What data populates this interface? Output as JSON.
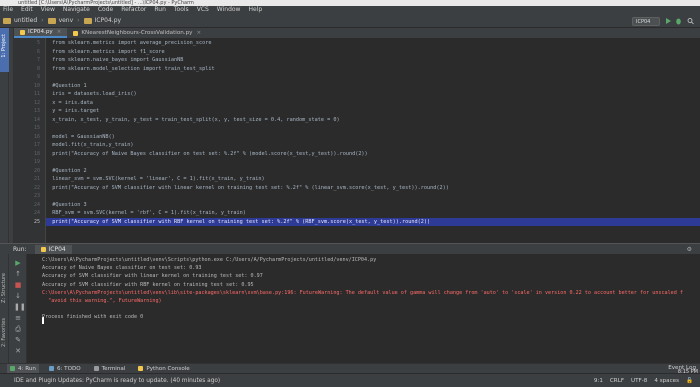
{
  "window": {
    "title": "untitled [C:\\Users\\A\\PycharmProjects\\untitled] - ...\\ICP04.py - PyCharm"
  },
  "menu": [
    "File",
    "Edit",
    "View",
    "Navigate",
    "Code",
    "Refactor",
    "Run",
    "Tools",
    "VCS",
    "Window",
    "Help"
  ],
  "breadcrumb": [
    "untitled",
    "venv",
    "ICP04.py"
  ],
  "run_config": "ICP04",
  "side_labels": {
    "project": "1: Project",
    "structure": "Z: Structure",
    "favorites": "2: Favorites"
  },
  "editor_tabs": [
    {
      "label": "ICP04.py",
      "active": true
    },
    {
      "label": "KNearestNeighbours-CrossValidation.py",
      "active": false
    }
  ],
  "code_lines": [
    {
      "num": "5",
      "text": "  from sklearn.metrics import average_precision_score"
    },
    {
      "num": "6",
      "text": "  from sklearn.metrics import f1_score"
    },
    {
      "num": "7",
      "text": "  from sklearn.naive_bayes import GaussianNB"
    },
    {
      "num": "8",
      "text": "  from sklearn.model_selection import train_test_split"
    },
    {
      "num": "9",
      "text": ""
    },
    {
      "num": "10",
      "text": "  #Question 1"
    },
    {
      "num": "11",
      "text": "  iris = datasets.load_iris()"
    },
    {
      "num": "12",
      "text": "  x = iris.data"
    },
    {
      "num": "13",
      "text": "  y = iris.target"
    },
    {
      "num": "14",
      "text": "  x_train, x_test, y_train, y_test = train_test_split(x, y, test_size = 0.4, random_state = 0)"
    },
    {
      "num": "15",
      "text": ""
    },
    {
      "num": "16",
      "text": "  model = GaussianNB()"
    },
    {
      "num": "17",
      "text": "  model.fit(x_train,y_train)"
    },
    {
      "num": "18",
      "text": "  print(\"Accuracy of Naive Bayes classifier on test set: %.2f\" % (model.score(x_test,y_test)).round(2))"
    },
    {
      "num": "19",
      "text": ""
    },
    {
      "num": "20",
      "text": "  #Question 2"
    },
    {
      "num": "21",
      "text": "  linear_svm = svm.SVC(kernel = 'linear', C = 1).fit(x_train, y_train)"
    },
    {
      "num": "22",
      "text": "  print(\"Accuracy of SVM classifier with linear kernel on training test set: %.2f\" % (linear_svm.score(x_test, y_test)).round(2))"
    },
    {
      "num": "23",
      "text": ""
    },
    {
      "num": "24",
      "text": "  #Question 3"
    },
    {
      "num": "24",
      "text": "  RBF_svm = svm.SVC(kernel = 'rbf', C = 1).fit(x_train, y_train)"
    },
    {
      "num": "25",
      "text": "  print(\"Accuracy of SVM classifier with RBF kernel on training test set: %.2f\" % (RBF_svm.score(x_test, y_test)).round(2))",
      "current": true
    }
  ],
  "run_panel": {
    "label": "Run:",
    "tab": "ICP04"
  },
  "console_lines": [
    {
      "text": "C:\\Users\\A\\PycharmProjects\\untitled\\venv\\Scripts\\python.exe C:/Users/A/PycharmProjects/untitled/venv/ICP04.py",
      "warn": false
    },
    {
      "text": "Accuracy of Naive Bayes classifier on test set: 0.93",
      "warn": false
    },
    {
      "text": "Accuracy of SVM classifier with linear kernel on training test set: 0.97",
      "warn": false
    },
    {
      "text": "Accuracy of SVM classifier with RBF kernel on training test set: 0.95",
      "warn": false
    },
    {
      "text": "C:\\Users\\A\\PycharmProjects\\untitled\\venv\\lib\\site-packages\\sklearn\\svm\\base.py:196: FutureWarning: The default value of gamma will change from 'auto' to 'scale' in version 0.22 to account better for unscaled f",
      "warn": true
    },
    {
      "text": "  \"avoid this warning.\", FutureWarning)",
      "warn": true
    },
    {
      "text": "",
      "warn": false
    },
    {
      "text": "Process finished with exit code 0",
      "warn": false
    }
  ],
  "bottom_tabs": [
    {
      "label": "4: Run",
      "active": true
    },
    {
      "label": "6: TODO",
      "active": false
    },
    {
      "label": "Terminal",
      "active": false
    },
    {
      "label": "Python Console",
      "active": false
    }
  ],
  "event_log": "Event Log",
  "status": {
    "message": "IDE and Plugin Updates: PyCharm is ready to update. (40 minutes ago)",
    "position": "9:1",
    "line_sep": "CRLF",
    "encoding": "UTF-8",
    "indent": "4 spaces"
  },
  "clock": "8:15 PM"
}
